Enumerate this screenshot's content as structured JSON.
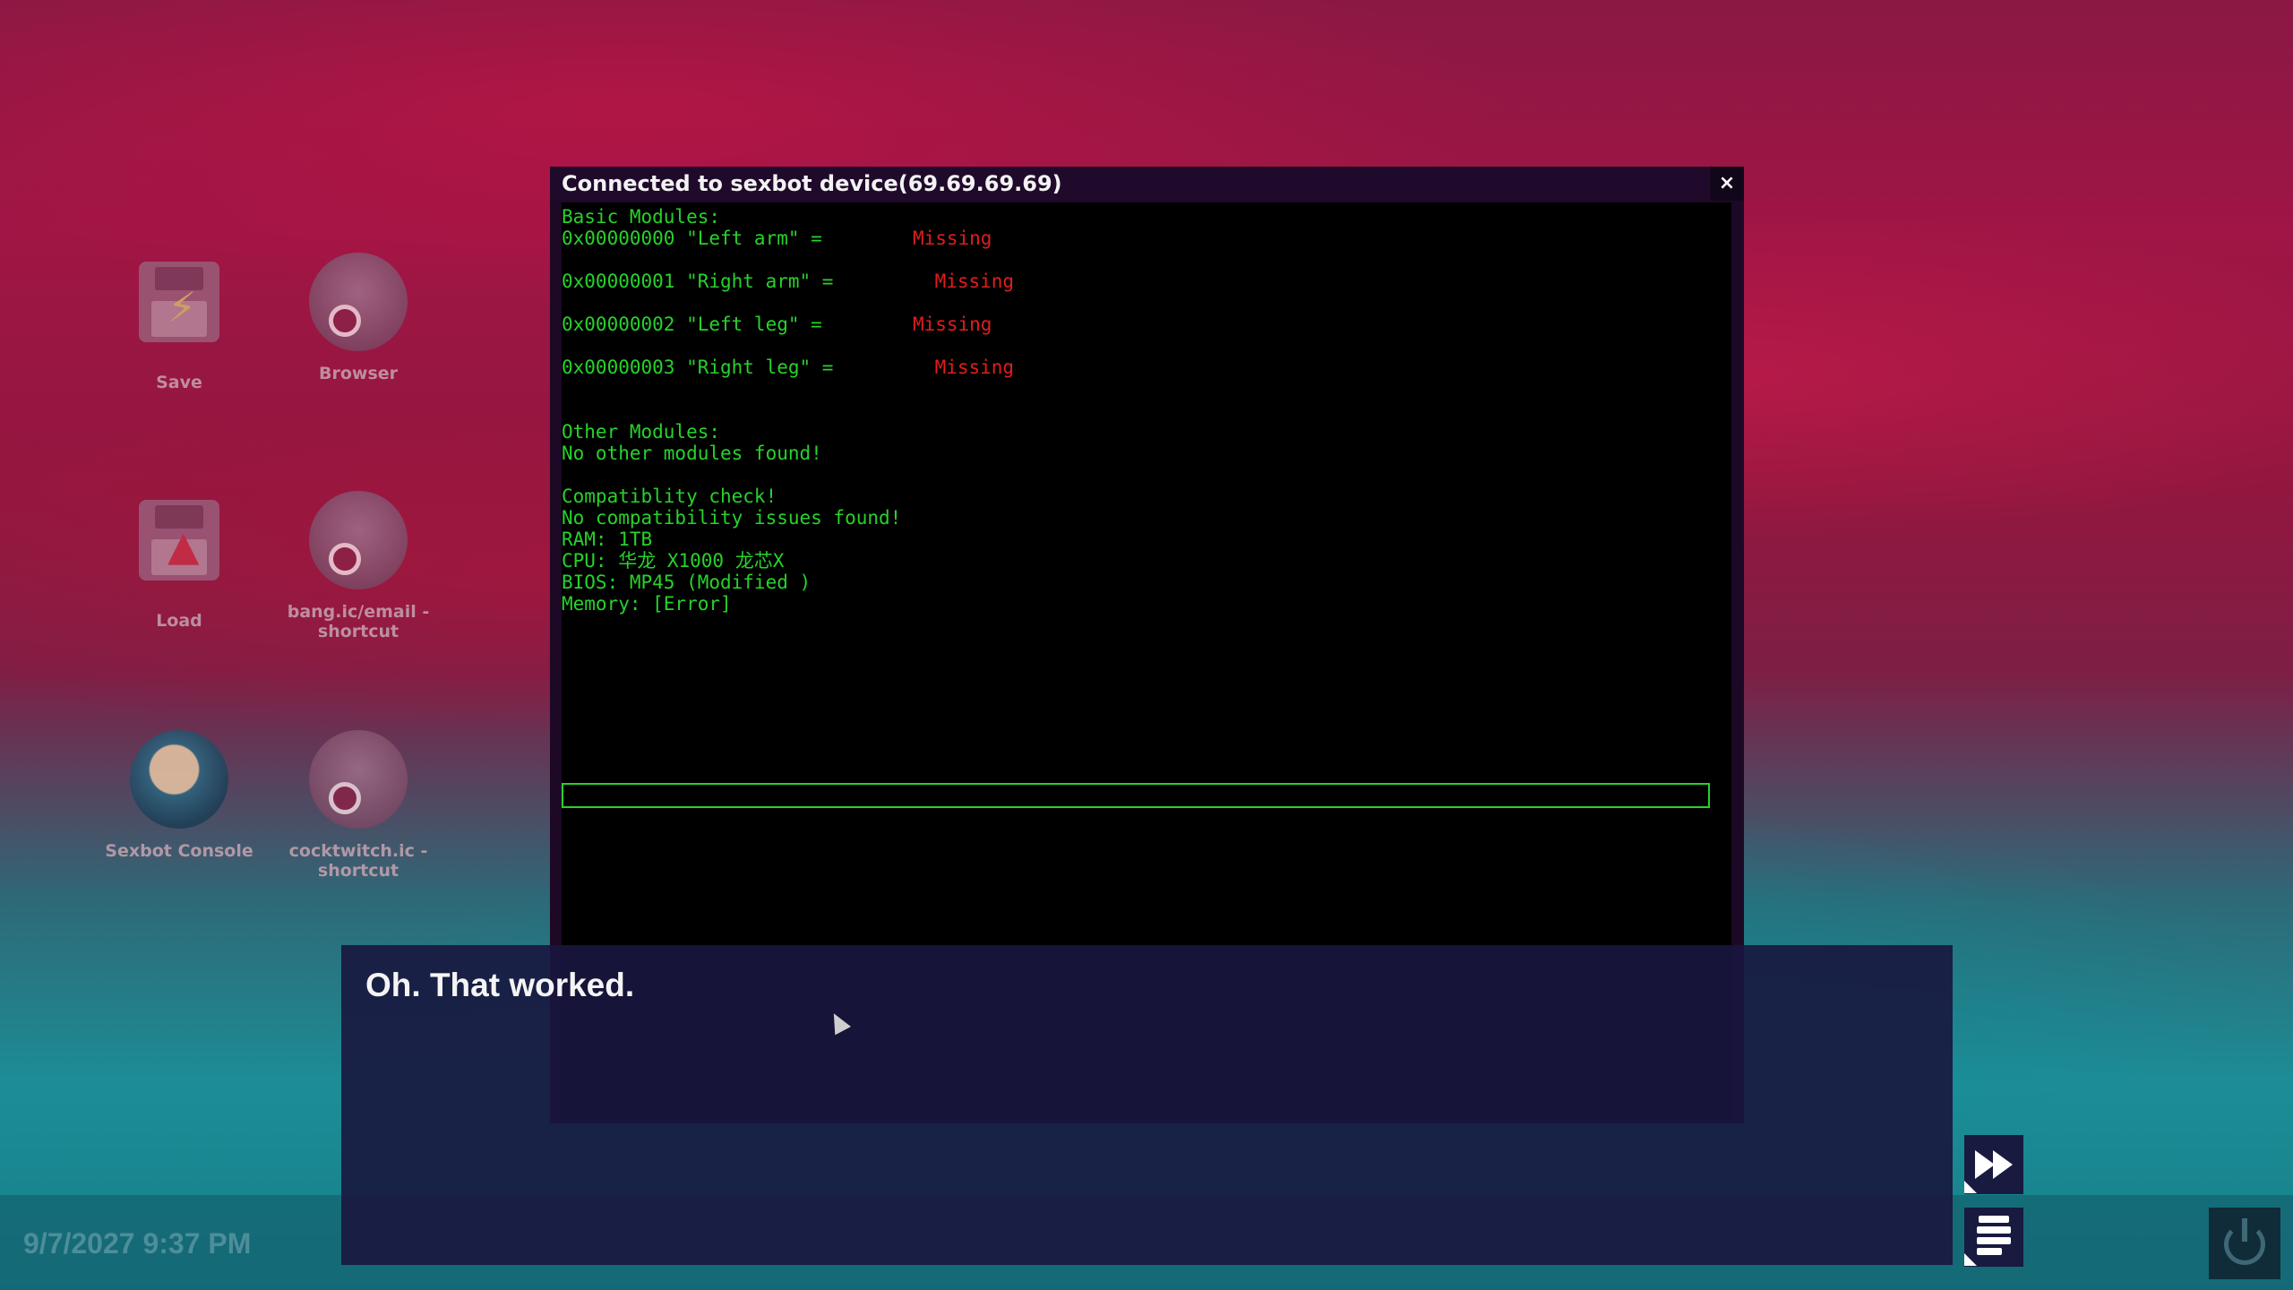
{
  "desktop": {
    "icons": [
      {
        "label": "Save"
      },
      {
        "label": "Browser"
      },
      {
        "label": "Load"
      },
      {
        "label": "bang.ic/email - shortcut"
      },
      {
        "label": "Sexbot Console"
      },
      {
        "label": "cocktwitch.ic - shortcut"
      }
    ]
  },
  "terminal": {
    "title": "Connected to sexbot device(69.69.69.69)",
    "close_label": "×",
    "lines": {
      "basic_header": "Basic Modules:",
      "m0_prefix": "0x00000000 \"Left arm\" =        ",
      "m0_status": "Missing",
      "m1_prefix": "0x00000001 \"Right arm\" =        ",
      "m1_status": "Missing",
      "m2_prefix": "0x00000002 \"Left leg\" =        ",
      "m2_status": "Missing",
      "m3_prefix": "0x00000003 \"Right leg\" =        ",
      "m3_status": "Missing",
      "other_header": "Other Modules:",
      "other_result": "No other modules found!",
      "compat_header": "Compatiblity check!",
      "compat_result": "No compatibility issues found!",
      "ram": "RAM: 1TB",
      "cpu": "CPU: 华龙 X1000 龙芯X",
      "bios": "BIOS: MP45 (Modified )",
      "memory": "Memory: [Error]"
    },
    "input_value": ""
  },
  "dialogue": {
    "text": "Oh. That worked."
  },
  "taskbar": {
    "datetime": "9/7/2027 9:37 PM"
  },
  "colors": {
    "terminal_text": "#27d22b",
    "missing_text": "#e01d1d",
    "dialogue_bg": "#18163e"
  }
}
